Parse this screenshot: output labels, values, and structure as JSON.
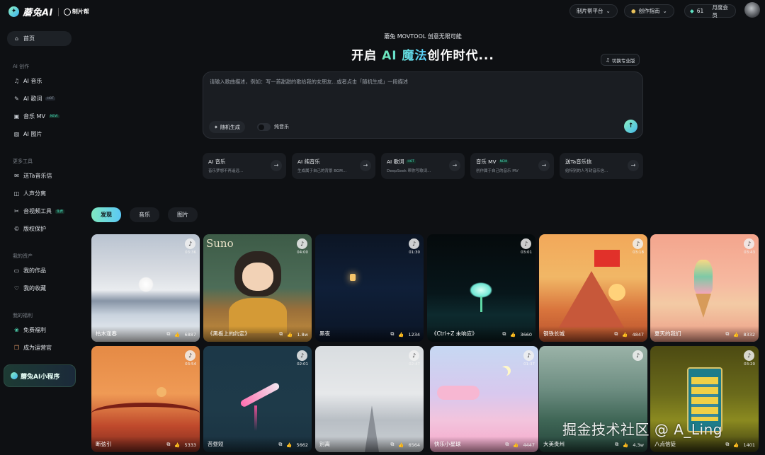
{
  "header": {
    "logo_mark": "✦",
    "logo_text": "蘑兔AI",
    "partner_text": "制片帮",
    "platform_menu": "制片帮平台",
    "guide_menu": "创作指南",
    "credits": "61",
    "membership": "月度会员",
    "chevron_icon": "chevron-down-icon"
  },
  "sidebar": {
    "home": "首页",
    "section_ai": "AI 创作",
    "ai_items": [
      {
        "label": "AI 音乐",
        "icon": "♫",
        "tag": ""
      },
      {
        "label": "AI 歌词",
        "icon": "✎",
        "tag": "HOT"
      },
      {
        "label": "音乐 MV",
        "icon": "▣",
        "tag": "NEW"
      },
      {
        "label": "AI 图片",
        "icon": "▨",
        "tag": ""
      }
    ],
    "section_tools": "更多工具",
    "tool_items": [
      {
        "label": "送Ta音乐信",
        "icon": "✉",
        "tag": ""
      },
      {
        "label": "人声分离",
        "icon": "◫",
        "tag": ""
      },
      {
        "label": "音视频工具",
        "icon": "✂",
        "tag": "免费"
      },
      {
        "label": "版权保护",
        "icon": "©",
        "tag": ""
      }
    ],
    "section_assets": "我的资产",
    "asset_items": [
      {
        "label": "我的作品",
        "icon": "▭"
      },
      {
        "label": "我的收藏",
        "icon": "♡"
      }
    ],
    "section_benefits": "我的福利",
    "benefit_items": [
      {
        "label": "免费福利",
        "icon": "❀"
      },
      {
        "label": "成为运营官",
        "icon": "❒"
      }
    ],
    "mini_program": "蘑兔AI小程序"
  },
  "hero": {
    "subtitle": "蘑兔 MOVTOOL  创意无限可能",
    "title_part1": "开启 ",
    "title_part2": "AI 魔法",
    "title_part3": "创作时代...",
    "pro_switch": "切换专业版"
  },
  "prompt": {
    "placeholder": "请输入歌曲描述，例如：写一首甜甜的歌给我的女朋友...或者点击「随机生成」一段描述",
    "random_button": "随机生成",
    "pure_music_label": "纯音乐",
    "send_icon": "↑"
  },
  "features": [
    {
      "name": "AI 音乐",
      "tag": "",
      "desc": "音乐梦想不再遥远..."
    },
    {
      "name": "AI 纯音乐",
      "tag": "",
      "desc": "生成属于自己的背景 BGM..."
    },
    {
      "name": "AI 歌词",
      "tag": "HOT",
      "desc": "DeepSeek 帮你写歌词..."
    },
    {
      "name": "音乐 MV",
      "tag": "NEW",
      "desc": "创作属于自己的音乐 MV"
    },
    {
      "name": "送Ta音乐信",
      "tag": "",
      "desc": "给特别的人写封音乐信..."
    }
  ],
  "tabs": [
    "发现",
    "音乐",
    "图片"
  ],
  "cards": [
    {
      "title": "枯木逢春",
      "duration": "03:36",
      "likes": "6887"
    },
    {
      "title": "《黑板上的约定》",
      "duration": "04:00",
      "likes": "1.8w"
    },
    {
      "title": "黑夜",
      "duration": "01:30",
      "likes": "1234"
    },
    {
      "title": "《Ctrl+Z 未响应》",
      "duration": "03:01",
      "likes": "3660"
    },
    {
      "title": "钢铁长城",
      "duration": "03:18",
      "likes": "4847"
    },
    {
      "title": "夏天的我们",
      "duration": "03:43",
      "likes": "8332"
    },
    {
      "title": "断弦引",
      "duration": "03:54",
      "likes": "5333"
    },
    {
      "title": "苦昼短",
      "duration": "02:01",
      "likes": "5662"
    },
    {
      "title": "别离",
      "duration": "02:47",
      "likes": "6564"
    },
    {
      "title": "快乐小星球",
      "duration": "01:37",
      "likes": "4447"
    },
    {
      "title": "大美贵州",
      "duration": "",
      "likes": "4.3w"
    },
    {
      "title": "八点信徒",
      "duration": "03:20",
      "likes": "1401"
    }
  ],
  "card2_art_text": "Suno",
  "watermark": "掘金技术社区 @ A_Ling"
}
